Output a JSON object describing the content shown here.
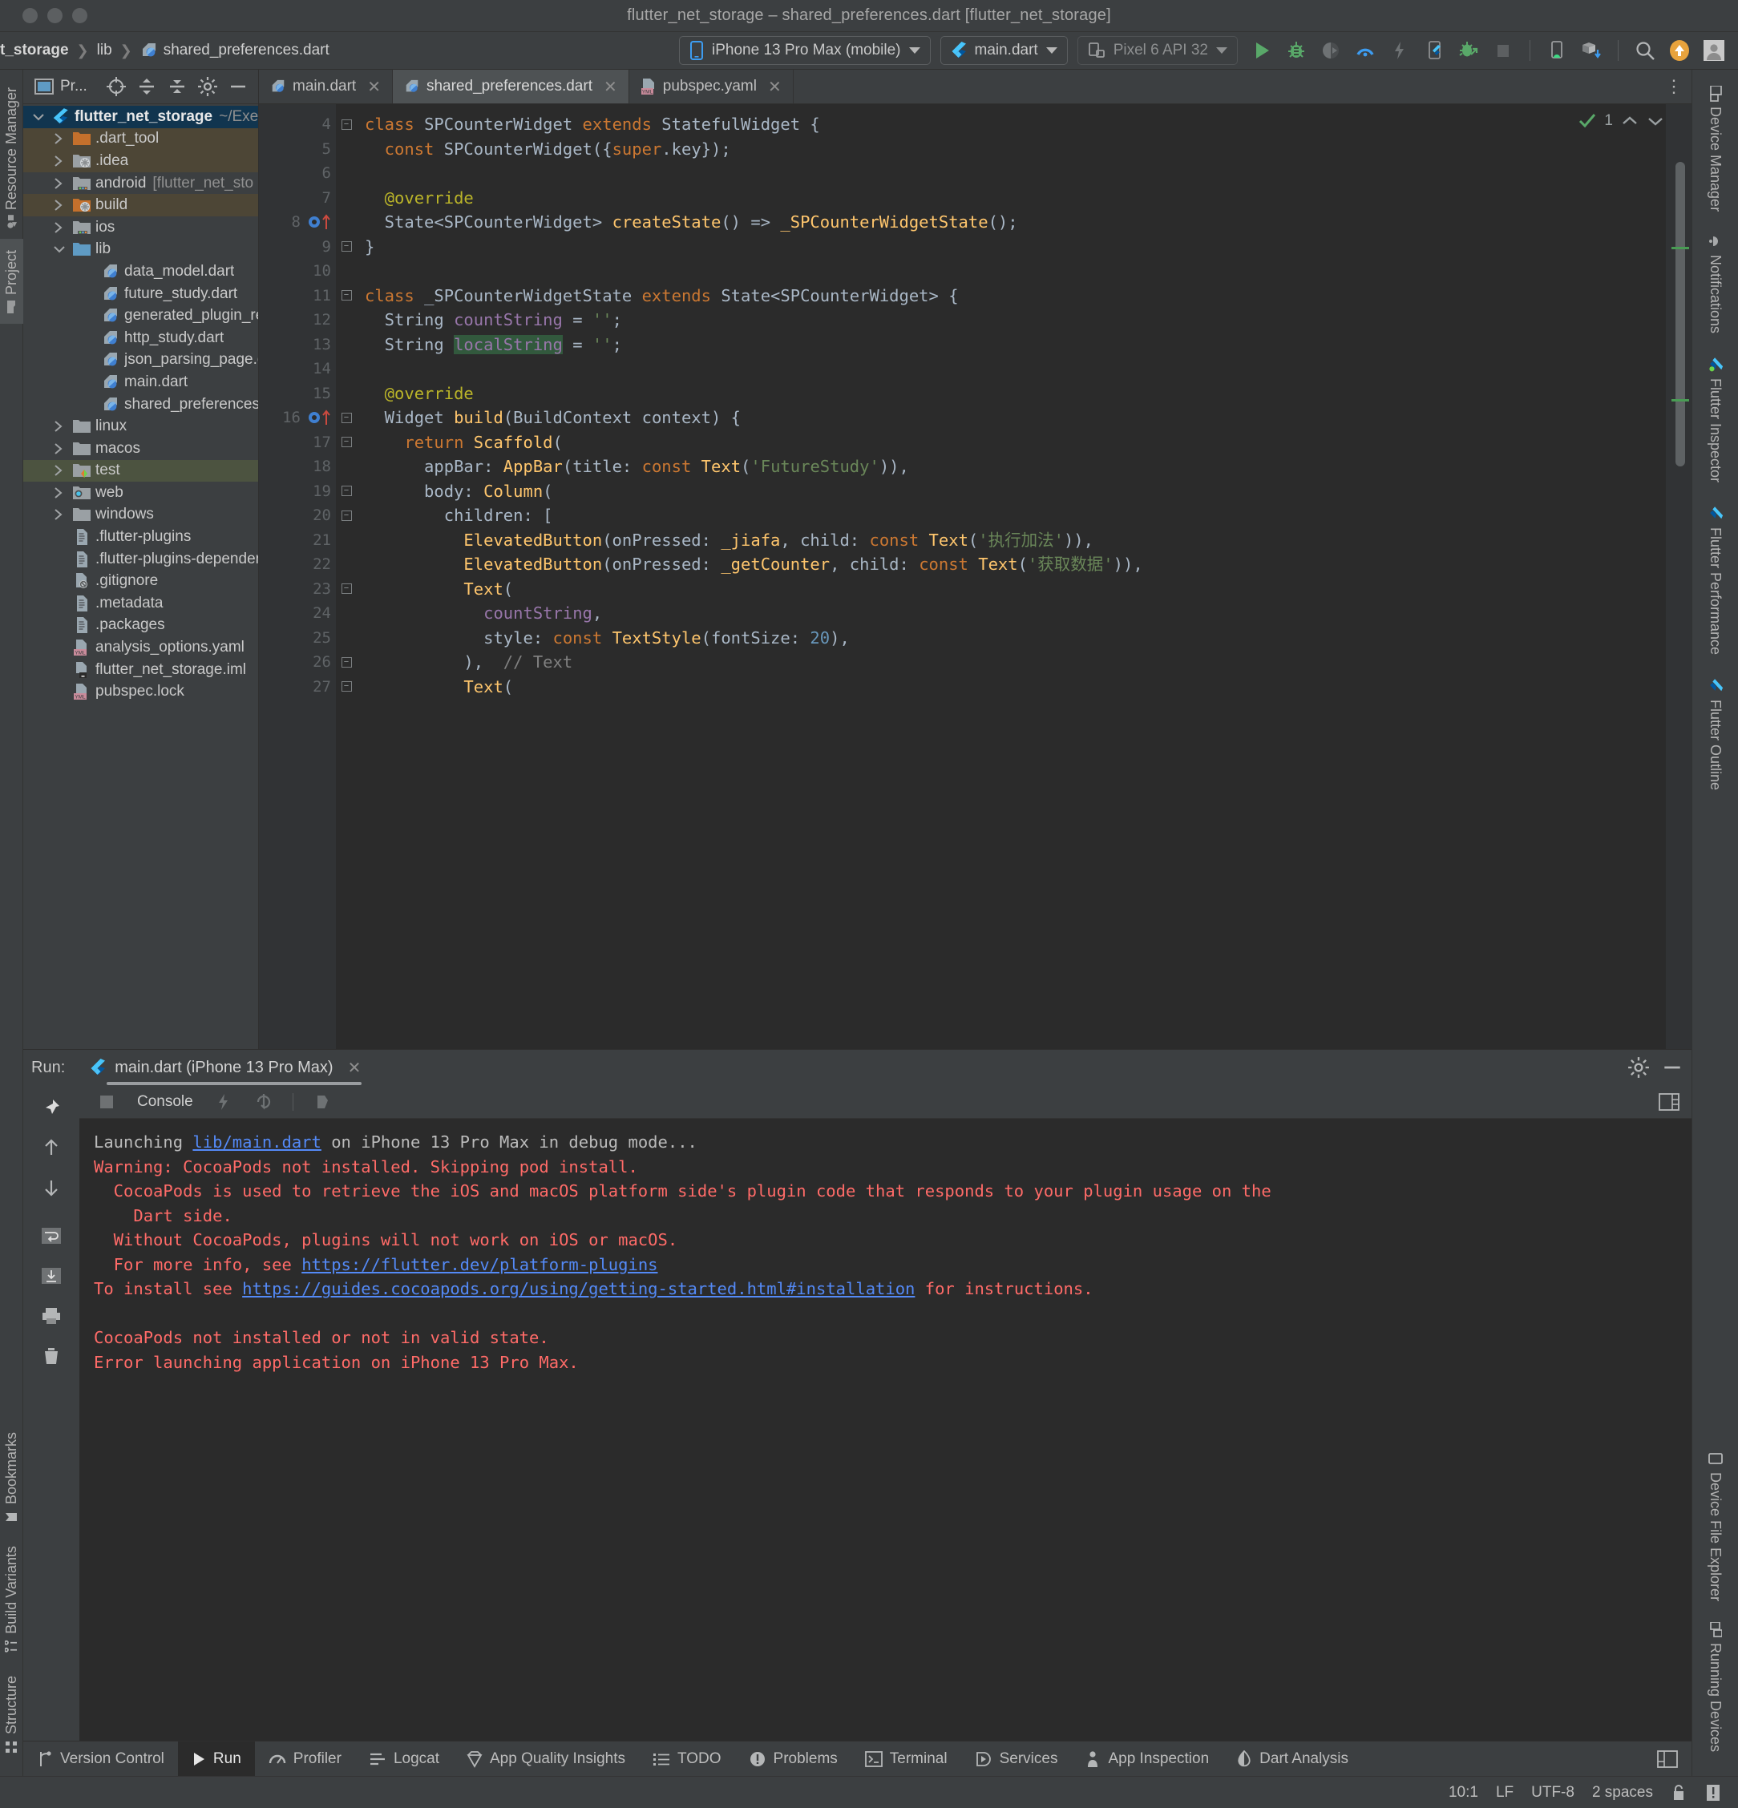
{
  "window": {
    "title": "flutter_net_storage – shared_preferences.dart [flutter_net_storage]"
  },
  "breadcrumb": {
    "items": [
      {
        "label": "t_storage",
        "icon": "",
        "bold": true
      },
      {
        "label": "lib",
        "icon": ""
      },
      {
        "label": "shared_preferences.dart",
        "icon": "dart-file-icon"
      }
    ]
  },
  "toolbar": {
    "device_selector": "iPhone 13 Pro Max (mobile)",
    "run_config": "main.dart",
    "android_device": "Pixel 6 API 32",
    "icons": [
      "run-icon",
      "debug-icon",
      "coverage-icon",
      "profile-icon",
      "hot-reload-icon",
      "flutter-attach-icon",
      "attach-debugger-icon",
      "stop-icon",
      "avd-manager-icon",
      "sdk-manager-icon",
      "search-icon",
      "update-icon",
      "account-icon"
    ]
  },
  "left_rail": {
    "tabs": [
      {
        "label": "Resource Manager",
        "icon": "resource-manager-icon"
      },
      {
        "label": "Project",
        "icon": "project-folder-icon",
        "active": true
      },
      {
        "label": "Bookmarks",
        "icon": "bookmark-icon"
      },
      {
        "label": "Build Variants",
        "icon": "build-variants-icon"
      },
      {
        "label": "Structure",
        "icon": "structure-icon"
      }
    ]
  },
  "right_rail": {
    "tabs": [
      {
        "label": "Device Manager",
        "icon": "device-manager-icon"
      },
      {
        "label": "Notifications",
        "icon": "notifications-bell-icon"
      },
      {
        "label": "Flutter Inspector",
        "icon": "flutter-icon"
      },
      {
        "label": "Flutter Performance",
        "icon": "flutter-icon"
      },
      {
        "label": "Flutter Outline",
        "icon": "flutter-icon"
      },
      {
        "label": "Device File Explorer",
        "icon": "device-file-explorer-icon"
      },
      {
        "label": "Running Devices",
        "icon": "running-devices-icon"
      }
    ]
  },
  "project_panel": {
    "title": "Pr...",
    "header_icons": [
      "select-opened-file-icon",
      "expand-all-icon",
      "collapse-all-icon",
      "settings-gear-icon",
      "hide-icon"
    ],
    "tree": [
      {
        "label": "flutter_net_storage",
        "sub": "~/Exer",
        "arrow": "down",
        "icon": "flutter-icon",
        "indent": 0,
        "bold": true,
        "select": "blue"
      },
      {
        "label": ".dart_tool",
        "arrow": "right",
        "icon": "folder-orange-icon",
        "indent": 1,
        "select": "brown"
      },
      {
        "label": ".idea",
        "arrow": "right",
        "icon": "folder-module-icon",
        "indent": 1,
        "select": "brown"
      },
      {
        "label": "android",
        "sub": "[flutter_net_sto",
        "arrow": "right",
        "icon": "folder-android-icon",
        "indent": 1
      },
      {
        "label": "build",
        "arrow": "right",
        "icon": "folder-orange-module-icon",
        "indent": 1,
        "select": "brown"
      },
      {
        "label": "ios",
        "arrow": "right",
        "icon": "folder-android-icon",
        "indent": 1
      },
      {
        "label": "lib",
        "arrow": "down",
        "icon": "folder-blue-icon",
        "indent": 1
      },
      {
        "label": "data_model.dart",
        "arrow": "",
        "icon": "dart-file-icon",
        "indent": 2
      },
      {
        "label": "future_study.dart",
        "arrow": "",
        "icon": "dart-file-icon",
        "indent": 2
      },
      {
        "label": "generated_plugin_regi",
        "arrow": "",
        "icon": "dart-file-icon",
        "indent": 2
      },
      {
        "label": "http_study.dart",
        "arrow": "",
        "icon": "dart-file-icon",
        "indent": 2
      },
      {
        "label": "json_parsing_page.dar",
        "arrow": "",
        "icon": "dart-file-icon",
        "indent": 2
      },
      {
        "label": "main.dart",
        "arrow": "",
        "icon": "dart-file-icon",
        "indent": 2
      },
      {
        "label": "shared_preferences.da",
        "arrow": "",
        "icon": "dart-file-icon",
        "indent": 2
      },
      {
        "label": "linux",
        "arrow": "right",
        "icon": "folder-gray-icon",
        "indent": 1
      },
      {
        "label": "macos",
        "arrow": "right",
        "icon": "folder-gray-icon",
        "indent": 1
      },
      {
        "label": "test",
        "arrow": "right",
        "icon": "folder-test-icon",
        "indent": 1,
        "select": "green"
      },
      {
        "label": "web",
        "arrow": "right",
        "icon": "folder-web-icon",
        "indent": 1
      },
      {
        "label": "windows",
        "arrow": "right",
        "icon": "folder-gray-icon",
        "indent": 1
      },
      {
        "label": ".flutter-plugins",
        "arrow": "",
        "icon": "text-file-icon",
        "indent": 1
      },
      {
        "label": ".flutter-plugins-dependen",
        "arrow": "",
        "icon": "text-file-icon",
        "indent": 1
      },
      {
        "label": ".gitignore",
        "arrow": "",
        "icon": "gitignore-file-icon",
        "indent": 1
      },
      {
        "label": ".metadata",
        "arrow": "",
        "icon": "text-file-icon",
        "indent": 1
      },
      {
        "label": ".packages",
        "arrow": "",
        "icon": "text-file-icon",
        "indent": 1
      },
      {
        "label": "analysis_options.yaml",
        "arrow": "",
        "icon": "yaml-file-icon",
        "indent": 1
      },
      {
        "label": "flutter_net_storage.iml",
        "arrow": "",
        "icon": "iml-file-icon",
        "indent": 1
      },
      {
        "label": "pubspec.lock",
        "arrow": "",
        "icon": "yaml-file-icon",
        "indent": 1
      }
    ]
  },
  "editor": {
    "tabs": [
      {
        "label": "main.dart",
        "icon": "dart-file-icon",
        "active": false
      },
      {
        "label": "shared_preferences.dart",
        "icon": "dart-file-icon",
        "active": true
      },
      {
        "label": "pubspec.yaml",
        "icon": "yaml-file-icon",
        "active": false
      }
    ],
    "inspection": {
      "count": "1",
      "status": "ok"
    },
    "lines": [
      {
        "n": "4",
        "fold": "minus-open",
        "tokens": [
          {
            "t": "class ",
            "c": "kw"
          },
          {
            "t": "SPCounterWidget ",
            "c": "cls"
          },
          {
            "t": "extends ",
            "c": "kw"
          },
          {
            "t": "StatefulWidget {",
            "c": "cls"
          }
        ]
      },
      {
        "n": "5",
        "fold": "",
        "tokens": [
          {
            "t": "  const ",
            "c": "kw"
          },
          {
            "t": "SPCounterWidget({",
            "c": "cls"
          },
          {
            "t": "super",
            "c": "kw"
          },
          {
            "t": ".key});",
            "c": "cls"
          }
        ]
      },
      {
        "n": "6",
        "fold": "",
        "tokens": []
      },
      {
        "n": "7",
        "fold": "",
        "tokens": [
          {
            "t": "  @override",
            "c": "ann"
          }
        ]
      },
      {
        "n": "8",
        "fold": "",
        "gmark": "override-marker",
        "tokens": [
          {
            "t": "  State<SPCounterWidget> ",
            "c": "cls"
          },
          {
            "t": "createState",
            "c": "fn"
          },
          {
            "t": "() => ",
            "c": "cls"
          },
          {
            "t": "_SPCounterWidgetState",
            "c": "fn"
          },
          {
            "t": "();",
            "c": "cls"
          }
        ]
      },
      {
        "n": "9",
        "fold": "minus-close",
        "tokens": [
          {
            "t": "}",
            "c": "cls"
          }
        ]
      },
      {
        "n": "10",
        "fold": "",
        "tokens": []
      },
      {
        "n": "11",
        "fold": "minus-open",
        "tokens": [
          {
            "t": "class ",
            "c": "kw"
          },
          {
            "t": "_SPCounterWidgetState ",
            "c": "cls"
          },
          {
            "t": "extends ",
            "c": "kw"
          },
          {
            "t": "State<SPCounterWidget> {",
            "c": "cls"
          }
        ]
      },
      {
        "n": "12",
        "fold": "",
        "tokens": [
          {
            "t": "  String ",
            "c": "cls"
          },
          {
            "t": "countString",
            "c": "fld"
          },
          {
            "t": " = ",
            "c": "cls"
          },
          {
            "t": "''",
            "c": "str"
          },
          {
            "t": ";",
            "c": "cls"
          }
        ]
      },
      {
        "n": "13",
        "fold": "",
        "tokens": [
          {
            "t": "  String ",
            "c": "cls"
          },
          {
            "t": "localString",
            "c": "fld hl"
          },
          {
            "t": " = ",
            "c": "cls"
          },
          {
            "t": "''",
            "c": "str"
          },
          {
            "t": ";",
            "c": "cls"
          }
        ]
      },
      {
        "n": "14",
        "fold": "",
        "tokens": []
      },
      {
        "n": "15",
        "fold": "",
        "tokens": [
          {
            "t": "  @override",
            "c": "ann"
          }
        ]
      },
      {
        "n": "16",
        "fold": "minus-open",
        "gmark": "override-marker",
        "tokens": [
          {
            "t": "  Widget ",
            "c": "cls"
          },
          {
            "t": "build",
            "c": "fn"
          },
          {
            "t": "(BuildContext context) {",
            "c": "cls"
          }
        ]
      },
      {
        "n": "17",
        "fold": "minus-open",
        "tokens": [
          {
            "t": "    return ",
            "c": "kw"
          },
          {
            "t": "Scaffold",
            "c": "fn"
          },
          {
            "t": "(",
            "c": "cls"
          }
        ]
      },
      {
        "n": "18",
        "fold": "",
        "tokens": [
          {
            "t": "      appBar: ",
            "c": "cls"
          },
          {
            "t": "AppBar",
            "c": "fn"
          },
          {
            "t": "(title: ",
            "c": "cls"
          },
          {
            "t": "const ",
            "c": "kw"
          },
          {
            "t": "Text",
            "c": "fn"
          },
          {
            "t": "(",
            "c": "cls"
          },
          {
            "t": "'FutureStudy'",
            "c": "str"
          },
          {
            "t": ")),",
            "c": "cls"
          }
        ]
      },
      {
        "n": "19",
        "fold": "minus-open",
        "tokens": [
          {
            "t": "      body: ",
            "c": "cls"
          },
          {
            "t": "Column",
            "c": "fn"
          },
          {
            "t": "(",
            "c": "cls"
          }
        ]
      },
      {
        "n": "20",
        "fold": "minus-open",
        "tokens": [
          {
            "t": "        children: [",
            "c": "cls"
          }
        ]
      },
      {
        "n": "21",
        "fold": "",
        "tokens": [
          {
            "t": "          ",
            "c": "cls"
          },
          {
            "t": "ElevatedButton",
            "c": "fn"
          },
          {
            "t": "(onPressed: ",
            "c": "cls"
          },
          {
            "t": "_jiafa",
            "c": "fn"
          },
          {
            "t": ", child: ",
            "c": "cls"
          },
          {
            "t": "const ",
            "c": "kw"
          },
          {
            "t": "Text",
            "c": "fn"
          },
          {
            "t": "(",
            "c": "cls"
          },
          {
            "t": "'执行加法'",
            "c": "str"
          },
          {
            "t": ")),",
            "c": "cls"
          }
        ]
      },
      {
        "n": "22",
        "fold": "",
        "tokens": [
          {
            "t": "          ",
            "c": "cls"
          },
          {
            "t": "ElevatedButton",
            "c": "fn"
          },
          {
            "t": "(onPressed: ",
            "c": "cls"
          },
          {
            "t": "_getCounter",
            "c": "fn"
          },
          {
            "t": ", child: ",
            "c": "cls"
          },
          {
            "t": "const ",
            "c": "kw"
          },
          {
            "t": "Text",
            "c": "fn"
          },
          {
            "t": "(",
            "c": "cls"
          },
          {
            "t": "'获取数据'",
            "c": "str"
          },
          {
            "t": ")),",
            "c": "cls"
          }
        ]
      },
      {
        "n": "23",
        "fold": "minus-open",
        "tokens": [
          {
            "t": "          ",
            "c": "cls"
          },
          {
            "t": "Text",
            "c": "fn"
          },
          {
            "t": "(",
            "c": "cls"
          }
        ]
      },
      {
        "n": "24",
        "fold": "",
        "tokens": [
          {
            "t": "            ",
            "c": "cls"
          },
          {
            "t": "countString",
            "c": "fld"
          },
          {
            "t": ",",
            "c": "cls"
          }
        ]
      },
      {
        "n": "25",
        "fold": "",
        "tokens": [
          {
            "t": "            style: ",
            "c": "cls"
          },
          {
            "t": "const ",
            "c": "kw"
          },
          {
            "t": "TextStyle",
            "c": "fn"
          },
          {
            "t": "(fontSize: ",
            "c": "cls"
          },
          {
            "t": "20",
            "c": "num"
          },
          {
            "t": "),",
            "c": "cls"
          }
        ]
      },
      {
        "n": "26",
        "fold": "minus-close",
        "tokens": [
          {
            "t": "          ),  ",
            "c": "cls"
          },
          {
            "t": "// Text",
            "c": "cmt"
          }
        ]
      },
      {
        "n": "27",
        "fold": "minus-open",
        "tokens": [
          {
            "t": "          ",
            "c": "cls"
          },
          {
            "t": "Text",
            "c": "fn"
          },
          {
            "t": "(",
            "c": "cls"
          }
        ]
      }
    ]
  },
  "run_panel": {
    "label": "Run:",
    "tab": "main.dart (iPhone 13 Pro Max)",
    "console_tab": "Console",
    "rail_icons": [
      "pin-icon",
      "scroll-up-icon",
      "scroll-down-icon",
      "soft-wrap-icon",
      "scroll-to-end-icon",
      "print-icon",
      "clear-all-icon"
    ],
    "head_icons": [
      "settings-gear-icon",
      "hide-icon"
    ],
    "toolbar_icons": [
      "stop-icon",
      "hot-reload-icon",
      "hot-restart-icon",
      "open-devtools-icon"
    ],
    "console_lines": [
      {
        "segments": [
          {
            "t": "Launching ",
            "c": "c-white"
          },
          {
            "t": "lib/main.dart",
            "c": "c-link"
          },
          {
            "t": " on iPhone 13 Pro Max in debug mode...",
            "c": "c-white"
          }
        ]
      },
      {
        "segments": [
          {
            "t": "Warning: CocoaPods not installed. Skipping pod install.",
            "c": "c-red"
          }
        ]
      },
      {
        "segments": [
          {
            "t": "  CocoaPods is used to retrieve the iOS and macOS platform side's plugin code that responds to your plugin usage on the",
            "c": "c-red"
          }
        ]
      },
      {
        "segments": [
          {
            "t": "    Dart side.",
            "c": "c-red"
          }
        ]
      },
      {
        "segments": [
          {
            "t": "  Without CocoaPods, plugins will not work on iOS or macOS.",
            "c": "c-red"
          }
        ]
      },
      {
        "segments": [
          {
            "t": "  For more info, see ",
            "c": "c-red"
          },
          {
            "t": "https://flutter.dev/platform-plugins",
            "c": "c-link"
          }
        ]
      },
      {
        "segments": [
          {
            "t": "To install see ",
            "c": "c-red"
          },
          {
            "t": "https://guides.cocoapods.org/using/getting-started.html#installation",
            "c": "c-link"
          },
          {
            "t": " for instructions.",
            "c": "c-red"
          }
        ]
      },
      {
        "segments": [
          {
            "t": "",
            "c": "c-red"
          }
        ]
      },
      {
        "segments": [
          {
            "t": "CocoaPods not installed or not in valid state.",
            "c": "c-red"
          }
        ]
      },
      {
        "segments": [
          {
            "t": "Error launching application on iPhone 13 Pro Max.",
            "c": "c-red"
          }
        ]
      }
    ]
  },
  "tool_window_bar": {
    "items": [
      {
        "label": "Version Control",
        "icon": "branch-icon",
        "active": false
      },
      {
        "label": "Run",
        "icon": "run-triangle-icon",
        "active": true
      },
      {
        "label": "Profiler",
        "icon": "profiler-icon",
        "active": false
      },
      {
        "label": "Logcat",
        "icon": "logcat-icon",
        "active": false
      },
      {
        "label": "App Quality Insights",
        "icon": "diamond-icon",
        "active": false
      },
      {
        "label": "TODO",
        "icon": "todo-list-icon",
        "active": false
      },
      {
        "label": "Problems",
        "icon": "problems-icon",
        "active": false
      },
      {
        "label": "Terminal",
        "icon": "terminal-icon",
        "active": false
      },
      {
        "label": "Services",
        "icon": "services-icon",
        "active": false
      },
      {
        "label": "App Inspection",
        "icon": "app-inspection-icon",
        "active": false
      },
      {
        "label": "Dart Analysis",
        "icon": "dart-analysis-icon",
        "active": false
      }
    ],
    "layout_icon": "layout-icon"
  },
  "status_bar": {
    "caret": "10:1",
    "line_separator": "LF",
    "encoding": "UTF-8",
    "indent": "2 spaces",
    "icons": [
      "lock-icon",
      "inspections-icon"
    ]
  },
  "colors": {
    "panel": "#3c3f41",
    "editor_bg": "#2b2b2b",
    "accent_blue": "#548af7",
    "error_red": "#ff6b68",
    "string_green": "#6a8759",
    "keyword_orange": "#cc7832",
    "method_yellow": "#ffc66d",
    "field_purple": "#9876aa",
    "run_green": "#499c54"
  }
}
